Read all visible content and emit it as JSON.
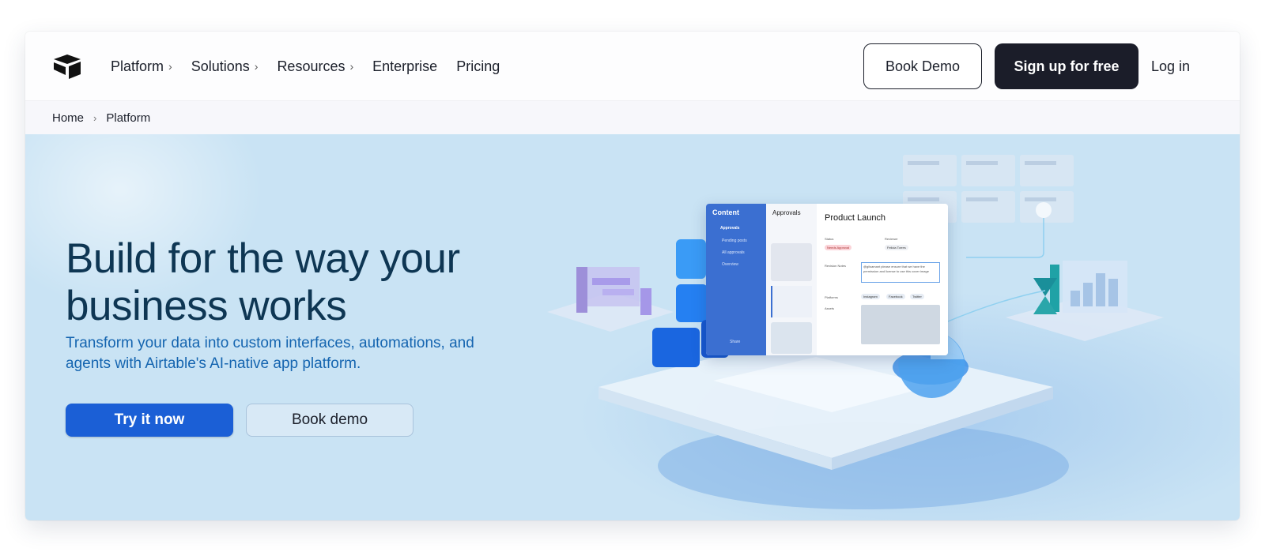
{
  "nav": {
    "items": [
      {
        "label": "Platform",
        "has_chevron": true
      },
      {
        "label": "Solutions",
        "has_chevron": true
      },
      {
        "label": "Resources",
        "has_chevron": true
      },
      {
        "label": "Enterprise",
        "has_chevron": false
      },
      {
        "label": "Pricing",
        "has_chevron": false
      }
    ],
    "chevron": "›",
    "book_demo": "Book Demo",
    "signup": "Sign up for free",
    "login": "Log in"
  },
  "breadcrumb": {
    "items": [
      "Home",
      "Platform"
    ],
    "separator": "›"
  },
  "hero": {
    "headline": "Build for the way your business works",
    "subline": "Transform your data into custom interfaces, automations, and agents with Airtable's AI-native app platform.",
    "primary_cta": "Try it now",
    "secondary_cta": "Book demo"
  },
  "mockup": {
    "sidebar_title": "Content",
    "sidebar_items": [
      "Approvals",
      "Pending posts",
      "All approvals",
      "Overview"
    ],
    "share": "Share",
    "list_title": "Approvals",
    "panel_title": "Product Launch",
    "status_label": "Status",
    "status_value": "Needs Approval",
    "reviewer_label": "Reviewer",
    "reviewer_value": "Felicia Torres",
    "notes_label": "Revision Notes",
    "notes_value": "@gilsamant please ensure that we have the permission and license to use this cover image",
    "platforms_label": "Platforms",
    "platforms": [
      "Instagram",
      "Facebook",
      "Twitter"
    ],
    "assets_label": "Assets"
  },
  "colors": {
    "hero_bg": "#c9e3f4",
    "headline": "#0e3653",
    "subline": "#1565b0",
    "primary": "#1b5fd6",
    "dark_button": "#1b1d29"
  }
}
